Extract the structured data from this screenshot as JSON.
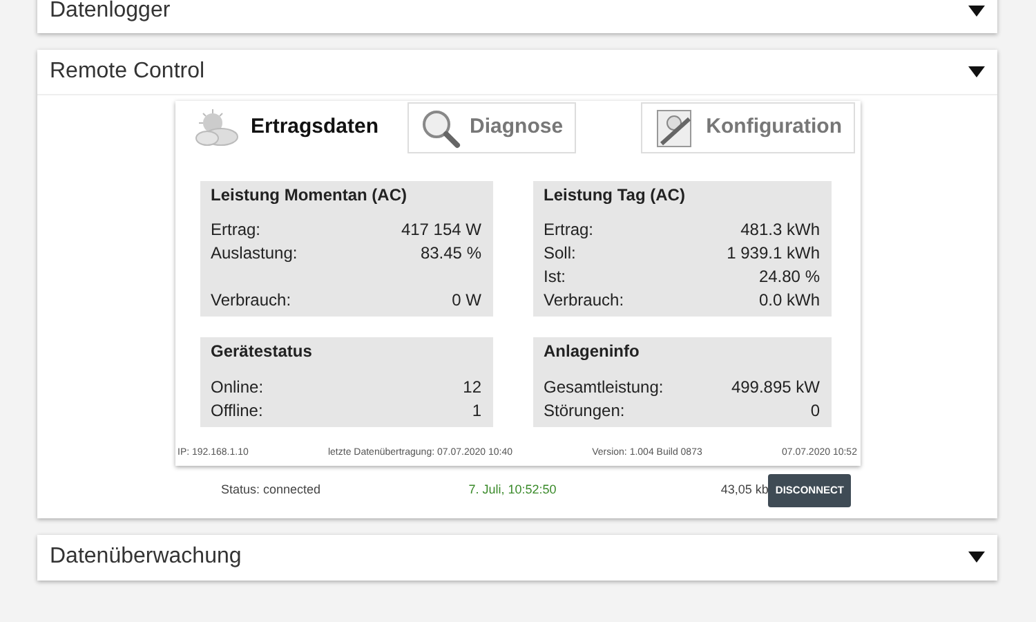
{
  "sections": [
    {
      "title": "Datenlogger",
      "expanded": false
    },
    {
      "title": "Remote Control",
      "expanded": true
    },
    {
      "title": "Datenüberwachung",
      "expanded": false
    }
  ],
  "tabs": [
    {
      "label": "Ertragsdaten",
      "kind": "weather",
      "selected": true
    },
    {
      "label": "Diagnose",
      "kind": "magnifier",
      "selected": false
    },
    {
      "label": "Konfiguration",
      "kind": "settings",
      "selected": false
    }
  ],
  "panels": [
    {
      "title": "Leistung Momentan (AC)",
      "rows": [
        {
          "label": "Ertrag:",
          "value": "417 154 W"
        },
        {
          "label": "Auslastung:",
          "value": "83.45 %"
        },
        {
          "label": "",
          "value": ""
        },
        {
          "label": "Verbrauch:",
          "value": "0 W"
        }
      ]
    },
    {
      "title": "Leistung Tag (AC)",
      "rows": [
        {
          "label": "Ertrag:",
          "value": "481.3 kWh"
        },
        {
          "label": "Soll:",
          "value": "1 939.1 kWh"
        },
        {
          "label": "Ist:",
          "value": "24.80 %"
        },
        {
          "label": "Verbrauch:",
          "value": "0.0 kWh"
        }
      ]
    },
    {
      "title": "Gerätestatus",
      "rows": [
        {
          "label": "Online:",
          "value": "12"
        },
        {
          "label": "Offline:",
          "value": "1"
        }
      ]
    },
    {
      "title": "Anlageninfo",
      "rows": [
        {
          "label": "Gesamtleistung:",
          "value": "499.895 kW"
        },
        {
          "label": "Störungen:",
          "value": "0"
        }
      ]
    }
  ],
  "footer": [
    "IP: 192.168.1.10",
    "letzte Datenübertragung: 07.07.2020 10:40",
    "Version: 1.004 Build 0873",
    "07.07.2020 10:52"
  ],
  "status": {
    "text": "Status: connected",
    "time": "7. Juli, 10:52:50",
    "size": "43,05 kb",
    "button": "DISCONNECT"
  }
}
